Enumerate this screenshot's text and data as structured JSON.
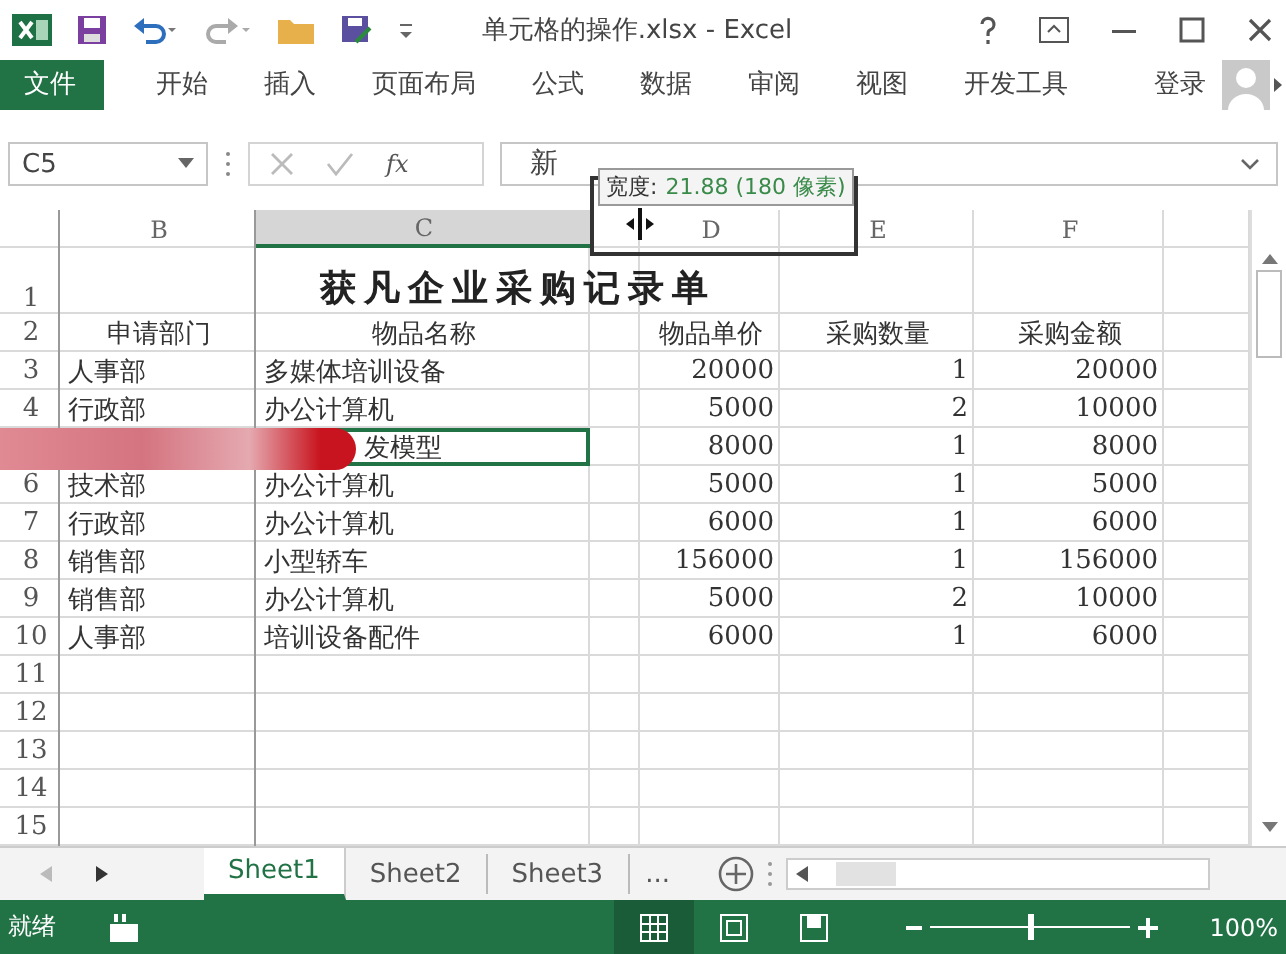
{
  "window": {
    "title": "单元格的操作.xlsx - Excel"
  },
  "ribbon_tabs": [
    {
      "label": "文件",
      "kind": "file"
    },
    {
      "label": "开始",
      "kind": "tab"
    },
    {
      "label": "插入",
      "kind": "tab"
    },
    {
      "label": "页面布局",
      "kind": "tab"
    },
    {
      "label": "公式",
      "kind": "tab"
    },
    {
      "label": "数据",
      "kind": "tab"
    },
    {
      "label": "审阅",
      "kind": "tab"
    },
    {
      "label": "视图",
      "kind": "tab"
    },
    {
      "label": "开发工具",
      "kind": "tab"
    }
  ],
  "account": {
    "label": "登录"
  },
  "formula_bar": {
    "name_box": "C5",
    "function_label": "fx",
    "value": "新"
  },
  "resize_tooltip": {
    "label": "宽度:",
    "value": "21.88 (180 像素)"
  },
  "sheet": {
    "columns": [
      {
        "label": "B",
        "selected": false
      },
      {
        "label": "C",
        "selected": true
      },
      {
        "label": "D",
        "selected": false
      },
      {
        "label": "E",
        "selected": false
      },
      {
        "label": "F",
        "selected": false
      }
    ],
    "title_row": {
      "number": "1",
      "text": "获凡企业采购记录单"
    },
    "rows": [
      {
        "number": "2",
        "kind": "header",
        "cells": [
          "申请部门",
          "物品名称",
          "物品单价",
          "采购数量",
          "采购金额"
        ]
      },
      {
        "number": "3",
        "kind": "data",
        "cells": [
          "人事部",
          "多媒体培训设备",
          "20000",
          "1",
          "20000"
        ]
      },
      {
        "number": "4",
        "kind": "data",
        "cells": [
          "行政部",
          "办公计算机",
          "5000",
          "2",
          "10000"
        ]
      },
      {
        "kind": "data",
        "redacted": true,
        "cells": [
          null,
          {
            "text": "发模型",
            "selected": true
          },
          "8000",
          "1",
          "8000"
        ]
      },
      {
        "number": "6",
        "kind": "data",
        "cells": [
          "技术部",
          "办公计算机",
          "5000",
          "1",
          "5000"
        ]
      },
      {
        "number": "7",
        "kind": "data",
        "cells": [
          "行政部",
          "办公计算机",
          "6000",
          "1",
          "6000"
        ]
      },
      {
        "number": "8",
        "kind": "data",
        "cells": [
          "销售部",
          "小型轿车",
          "156000",
          "1",
          "156000"
        ]
      },
      {
        "number": "9",
        "kind": "data",
        "cells": [
          "销售部",
          "办公计算机",
          "5000",
          "2",
          "10000"
        ]
      },
      {
        "number": "10",
        "kind": "data",
        "cells": [
          "人事部",
          "培训设备配件",
          "6000",
          "1",
          "6000"
        ]
      },
      {
        "number": "11",
        "kind": "data",
        "cells": []
      },
      {
        "number": "12",
        "kind": "data",
        "cells": []
      },
      {
        "number": "13",
        "kind": "data",
        "cells": []
      },
      {
        "number": "14",
        "kind": "data",
        "cells": []
      },
      {
        "number": "15",
        "kind": "data",
        "cells": []
      }
    ]
  },
  "sheet_tabs": [
    {
      "label": "Sheet1",
      "selected": true
    },
    {
      "label": "Sheet2",
      "selected": false
    },
    {
      "label": "Sheet3",
      "selected": false
    }
  ],
  "more_sheets": "...",
  "status_bar": {
    "status": "就绪",
    "zoom": {
      "level": 0.5,
      "reading": "100%"
    }
  }
}
